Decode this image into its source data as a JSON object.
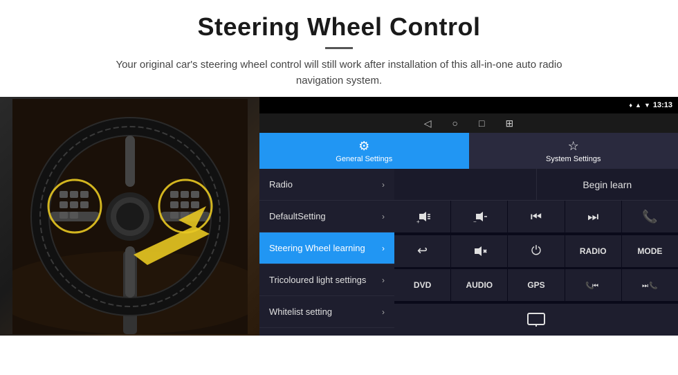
{
  "header": {
    "title": "Steering Wheel Control",
    "subtitle": "Your original car's steering wheel control will still work after installation of this all-in-one auto radio navigation system."
  },
  "status_bar": {
    "time": "13:13",
    "signal_icon": "▲",
    "wifi_icon": "▼",
    "battery_icon": "▪"
  },
  "nav_bar": {
    "back": "◁",
    "home": "○",
    "recents": "□",
    "menu": "⊞"
  },
  "tabs": {
    "general": {
      "label": "General Settings",
      "icon": "⚙"
    },
    "system": {
      "label": "System Settings",
      "icon": "☆"
    }
  },
  "menu": {
    "items": [
      {
        "label": "Radio",
        "active": false
      },
      {
        "label": "DefaultSetting",
        "active": false
      },
      {
        "label": "Steering Wheel learning",
        "active": true
      },
      {
        "label": "Tricoloured light settings",
        "active": false
      },
      {
        "label": "Whitelist setting",
        "active": false
      }
    ]
  },
  "controls": {
    "begin_learn": "Begin learn",
    "grid_row1": [
      "🔊+",
      "🔊−",
      "⏮",
      "⏭",
      "📞"
    ],
    "grid_row2": [
      "↩",
      "🔊×",
      "⏻",
      "RADIO",
      "MODE"
    ],
    "grid_row3": [
      "DVD",
      "AUDIO",
      "GPS",
      "📞⏮",
      "⏭📞"
    ],
    "extra": [
      "🖥"
    ]
  }
}
